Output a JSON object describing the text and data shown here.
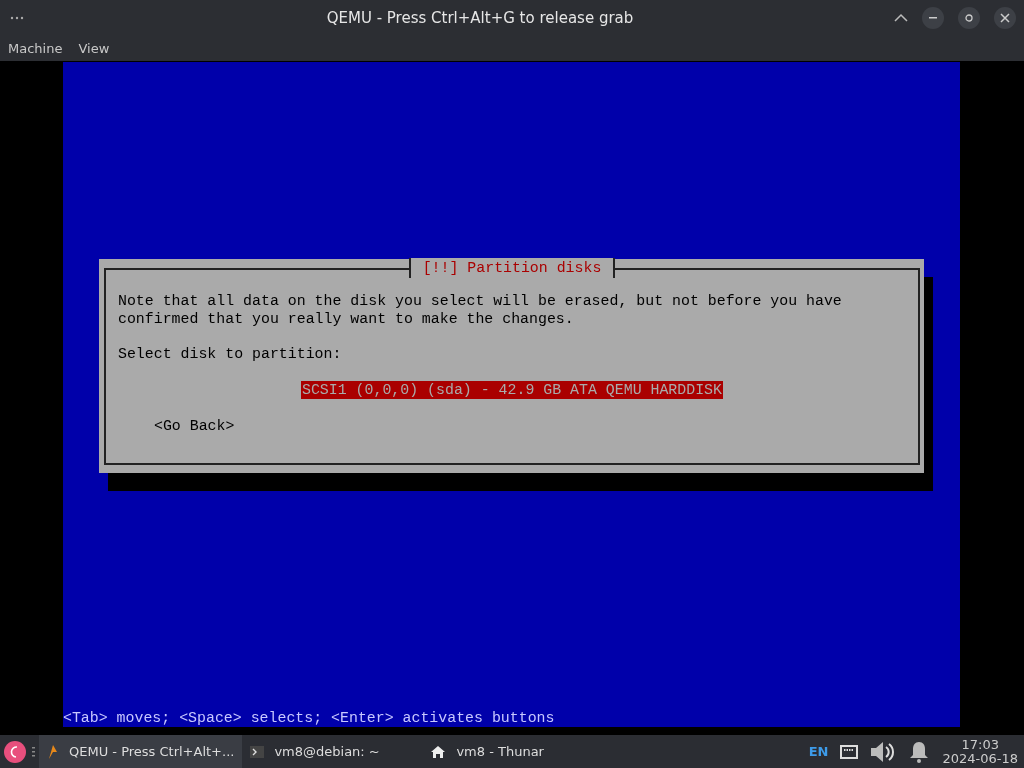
{
  "window": {
    "title": "QEMU - Press Ctrl+Alt+G to release grab"
  },
  "menu": [
    "Machine",
    "View"
  ],
  "installer": {
    "dialog": {
      "title": "[!!] Partition disks",
      "message": "Note that all data on the disk you select will be erased, but not before you have confirmed that you really want to make the changes.",
      "prompt": "Select disk to partition:",
      "options": [
        {
          "label": "SCSI1 (0,0,0) (sda) - 42.9 GB ATA QEMU HARDDISK",
          "selected": true
        }
      ],
      "back_button": "<Go Back>"
    },
    "help_line": "<Tab> moves; <Space> selects; <Enter> activates buttons"
  },
  "taskbar": {
    "tasks": [
      {
        "kind": "qemu",
        "label": "QEMU - Press Ctrl+Alt+...",
        "selected": true
      },
      {
        "kind": "terminal",
        "label": "vm8@debian: ~",
        "selected": false
      },
      {
        "kind": "folder",
        "label": "vm8 - Thunar",
        "selected": false
      }
    ],
    "language": "EN",
    "time": "17:03",
    "date": "2024-06-18"
  }
}
